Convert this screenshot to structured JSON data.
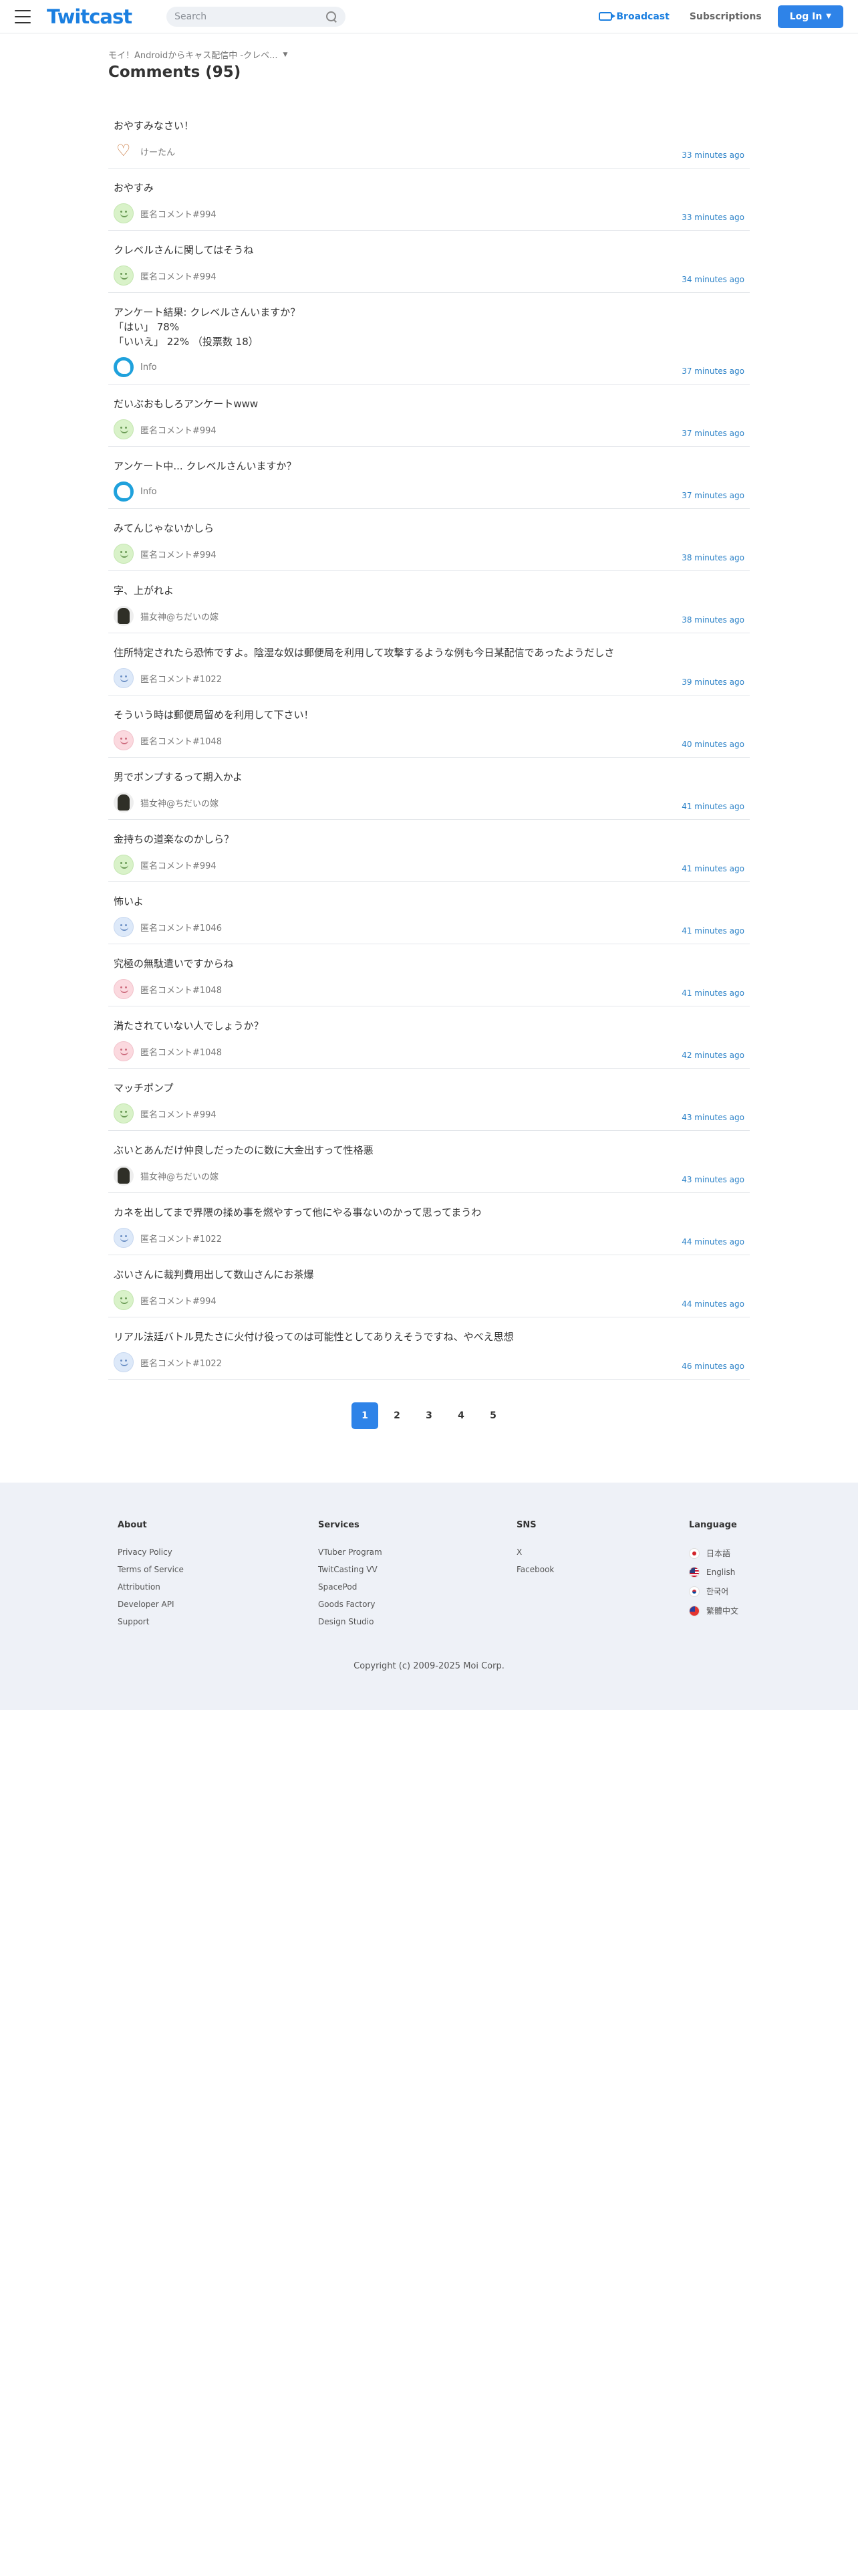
{
  "header": {
    "logo": "Twitcast",
    "search_placeholder": "Search",
    "broadcast_label": "Broadcast",
    "subscriptions_label": "Subscriptions",
    "login_label": "Log In"
  },
  "breadcrumb": "モイ！Androidからキャス配信中 -クレベ...",
  "page_title": "Comments (95)",
  "comments": [
    {
      "text": "おやすみなさい！",
      "user": "けーたん",
      "time": "33 minutes ago",
      "avatar": "heart"
    },
    {
      "text": "おやすみ",
      "user": "匿名コメント#994",
      "time": "33 minutes ago",
      "avatar": "green"
    },
    {
      "text": "クレベルさんに関してはそうね",
      "user": "匿名コメント#994",
      "time": "34 minutes ago",
      "avatar": "green"
    },
    {
      "text": "アンケート結果: クレベルさんいますか？\n「はい」 78%\n「いいえ」 22% （投票数 18）",
      "user": "Info",
      "time": "37 minutes ago",
      "avatar": "info"
    },
    {
      "text": "だいぶおもしろアンケートwww",
      "user": "匿名コメント#994",
      "time": "37 minutes ago",
      "avatar": "green"
    },
    {
      "text": "アンケート中... クレベルさんいますか？",
      "user": "Info",
      "time": "37 minutes ago",
      "avatar": "info"
    },
    {
      "text": "みてんじゃないかしら",
      "user": "匿名コメント#994",
      "time": "38 minutes ago",
      "avatar": "green"
    },
    {
      "text": "字、上がれよ",
      "user": "猫女神@ちだいの嫁",
      "time": "38 minutes ago",
      "avatar": "dark"
    },
    {
      "text": "住所特定されたら恐怖ですよ。陰湿な奴は郵便局を利用して攻撃するような例も今日某配信であったようだしさ",
      "user": "匿名コメント#1022",
      "time": "39 minutes ago",
      "avatar": "blue"
    },
    {
      "text": "そういう時は郵便局留めを利用して下さい！",
      "user": "匿名コメント#1048",
      "time": "40 minutes ago",
      "avatar": "pink"
    },
    {
      "text": "男でポンプするって期入かよ",
      "user": "猫女神@ちだいの嫁",
      "time": "41 minutes ago",
      "avatar": "dark"
    },
    {
      "text": "金持ちの道楽なのかしら？",
      "user": "匿名コメント#994",
      "time": "41 minutes ago",
      "avatar": "green"
    },
    {
      "text": "怖いよ",
      "user": "匿名コメント#1046",
      "time": "41 minutes ago",
      "avatar": "blue"
    },
    {
      "text": "究極の無駄遣いですからね",
      "user": "匿名コメント#1048",
      "time": "41 minutes ago",
      "avatar": "pink"
    },
    {
      "text": "満たされていない人でしょうか？",
      "user": "匿名コメント#1048",
      "time": "42 minutes ago",
      "avatar": "pink"
    },
    {
      "text": "マッチポンプ",
      "user": "匿名コメント#994",
      "time": "43 minutes ago",
      "avatar": "green"
    },
    {
      "text": "ぶいとあんだけ仲良しだったのに数に大金出すって性格悪",
      "user": "猫女神@ちだいの嫁",
      "time": "43 minutes ago",
      "avatar": "dark"
    },
    {
      "text": "カネを出してまで界隈の揉め事を燃やすって他にやる事ないのかって思ってまうわ",
      "user": "匿名コメント#1022",
      "time": "44 minutes ago",
      "avatar": "blue"
    },
    {
      "text": "ぶいさんに裁判費用出して数山さんにお茶爆",
      "user": "匿名コメント#994",
      "time": "44 minutes ago",
      "avatar": "green"
    },
    {
      "text": "リアル法廷バトル見たさに火付け役ってのは可能性としてありえそうですね、やべえ思想",
      "user": "匿名コメント#1022",
      "time": "46 minutes ago",
      "avatar": "blue"
    }
  ],
  "pagination": [
    "1",
    "2",
    "3",
    "4",
    "5"
  ],
  "footer": {
    "about_title": "About",
    "about_links": [
      "Privacy Policy",
      "Terms of Service",
      "Attribution",
      "Developer API",
      "Support"
    ],
    "services_title": "Services",
    "services_links": [
      "VTuber Program",
      "TwitCasting VV",
      "SpacePod",
      "Goods Factory",
      "Design Studio"
    ],
    "sns_title": "SNS",
    "sns_links": [
      "X",
      "Facebook"
    ],
    "language_title": "Language",
    "languages": [
      {
        "label": "日本語",
        "flag": "jp"
      },
      {
        "label": "English",
        "flag": "us"
      },
      {
        "label": "한국어",
        "flag": "kr"
      },
      {
        "label": "繁體中文",
        "flag": "tw"
      }
    ],
    "copyright": "Copyright (c) 2009-2025 Moi Corp."
  },
  "colors": {
    "accent": "#2e83e8",
    "logo": "#1b7fe0",
    "footer_bg": "#eef1f7"
  }
}
